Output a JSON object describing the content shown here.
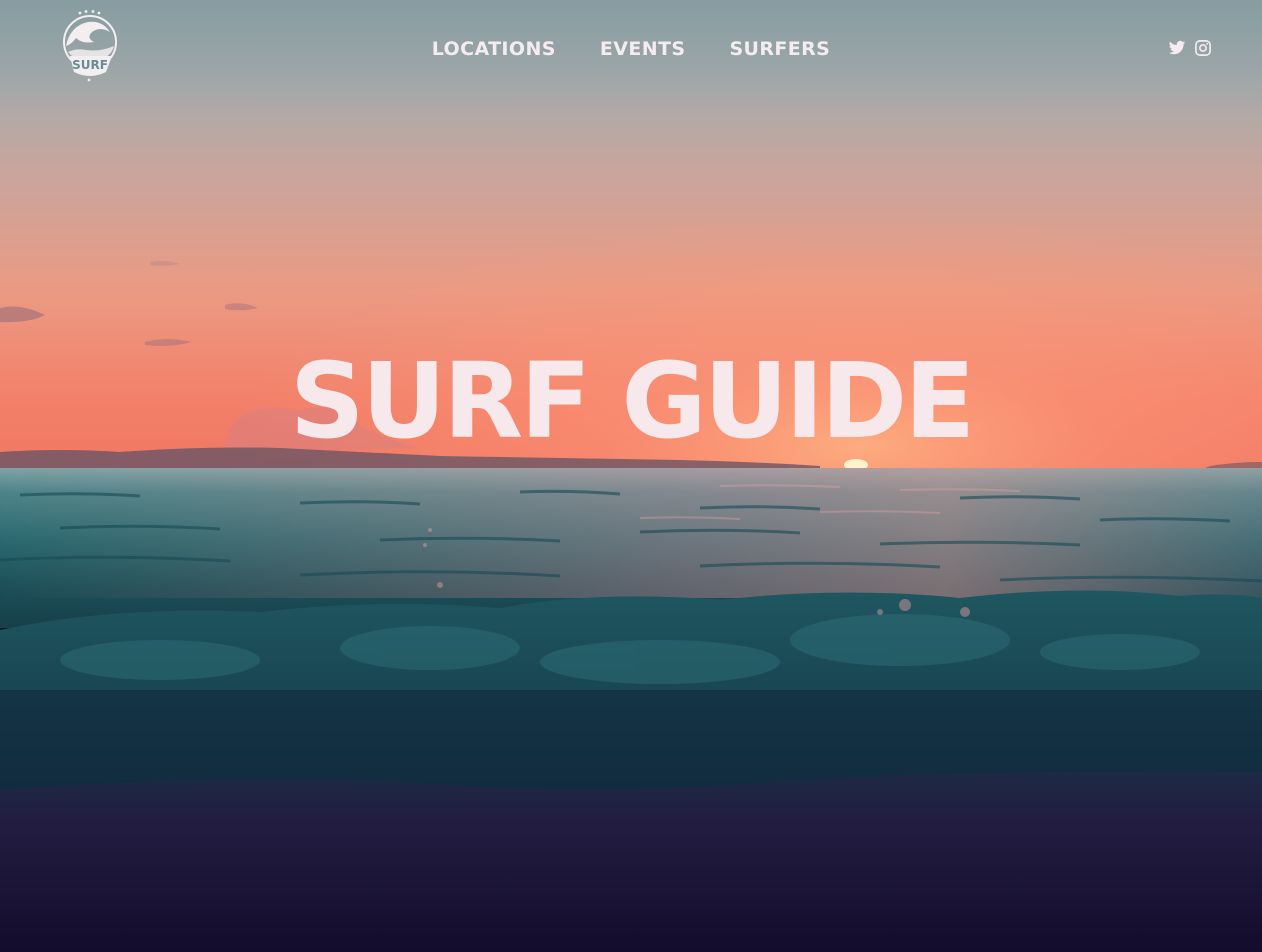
{
  "brand": {
    "logo_icon": "surf-badge-logo",
    "logo_text": "SURF"
  },
  "nav": {
    "items": [
      {
        "label": "LOCATIONS"
      },
      {
        "label": "EVENTS"
      },
      {
        "label": "SURFERS"
      }
    ]
  },
  "social": {
    "icons": [
      "twitter-icon",
      "instagram-icon"
    ]
  },
  "hero": {
    "title": "SURF GUIDE"
  },
  "colors": {
    "text": "#f4ecee",
    "sky_top": "#9aa8a9",
    "sunset": "#f0856a",
    "sea": "#1f5a62",
    "sand": "#1a1236"
  }
}
